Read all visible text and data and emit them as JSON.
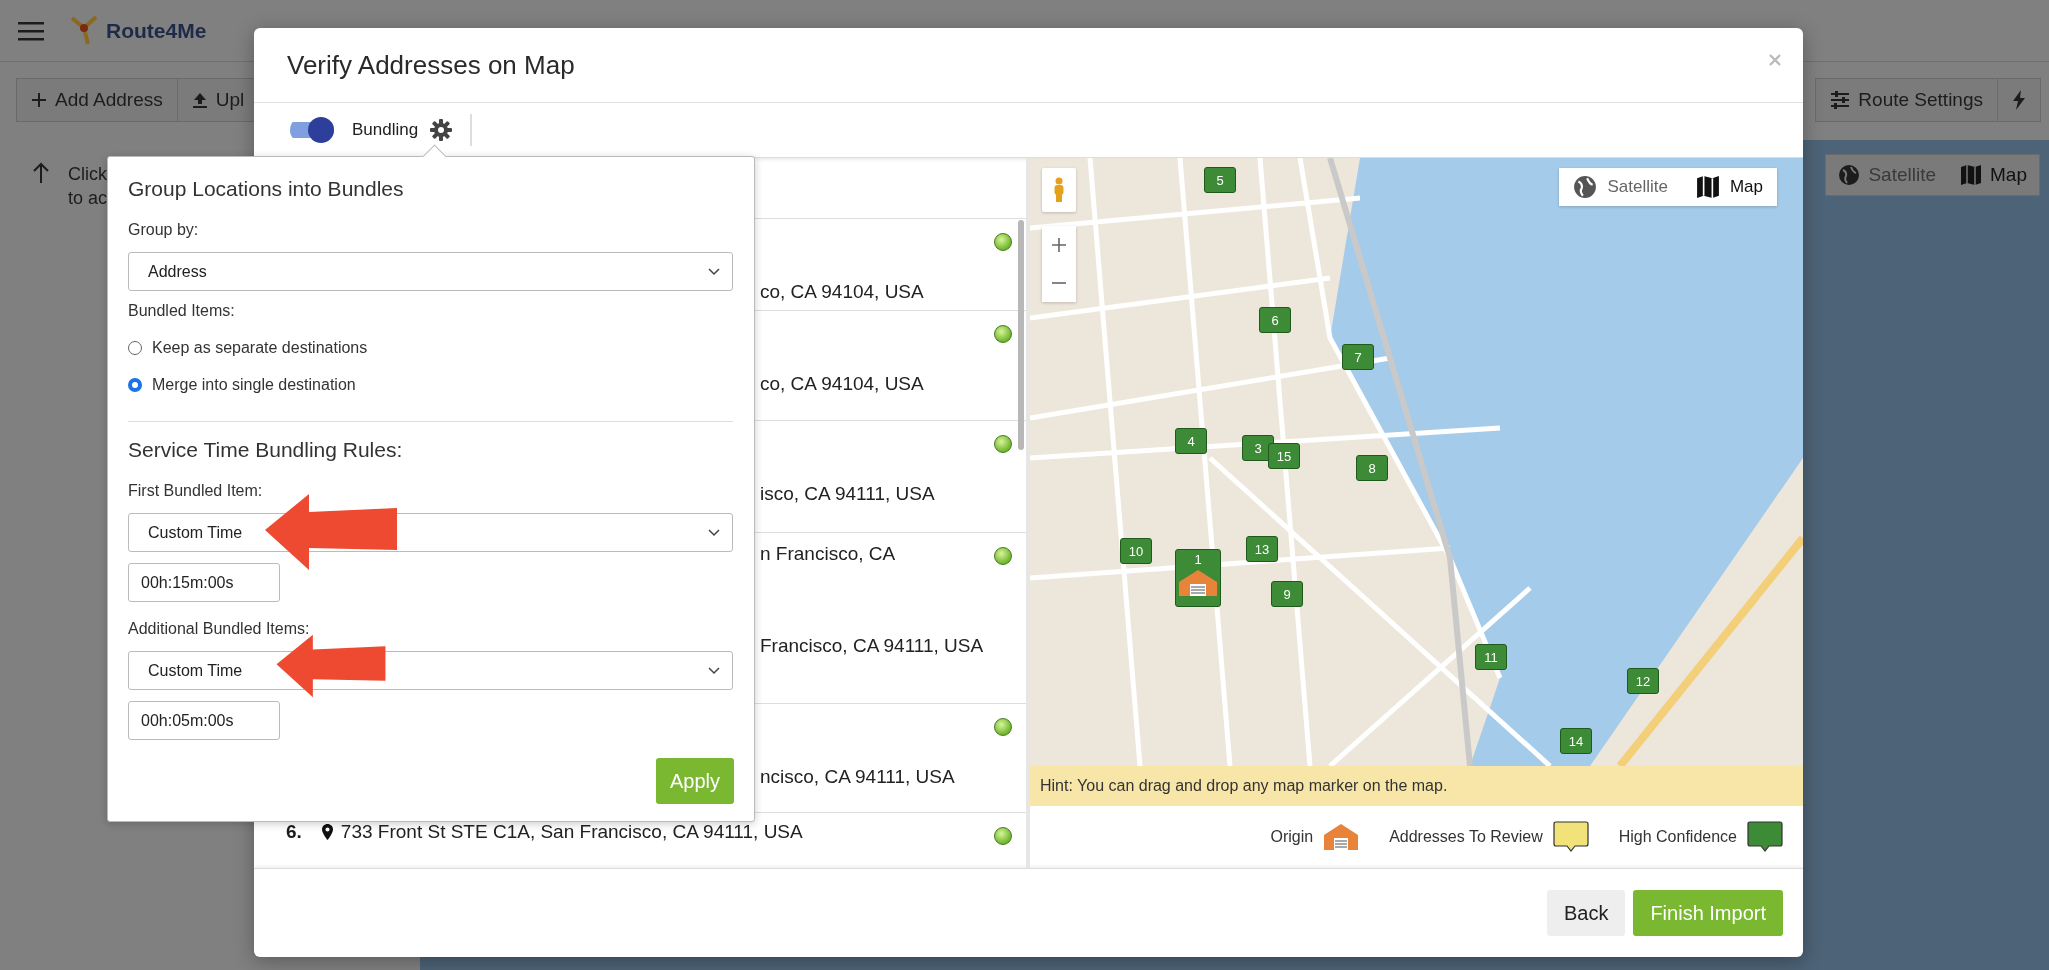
{
  "app": {
    "logo": "Route4Me",
    "toolbar_buttons": [
      "Add Address",
      "Upl"
    ],
    "hint_lines": [
      "Click",
      "to ac"
    ],
    "route_settings": "Route Settings",
    "map_types": [
      {
        "label": "Satellite",
        "selected": false
      },
      {
        "label": "Map",
        "selected": true
      }
    ]
  },
  "dialog": {
    "title": "Verify Addresses on Map",
    "bundling": {
      "label": "Bundling",
      "on": true
    },
    "addresses": [
      {
        "kind": "partial",
        "lines": [
          "co, CA 94104, USA"
        ]
      },
      {
        "kind": "partial",
        "lines": [
          "co, CA 94104, USA"
        ]
      },
      {
        "kind": "partial",
        "lines": [
          "isco, CA 94111, USA"
        ]
      },
      {
        "kind": "partial",
        "lines": [
          "n Francisco, CA",
          "Francisco, CA 94111, USA"
        ]
      },
      {
        "kind": "partial",
        "lines": [
          "ncisco, CA 94111, USA"
        ]
      },
      {
        "kind": "full",
        "number": "6.",
        "lines": [
          "733 Front St STE C1A, San Francisco, CA 94111, USA"
        ]
      }
    ],
    "map": {
      "map_types": [
        {
          "label": "Satellite",
          "selected": false
        },
        {
          "label": "Map",
          "selected": true
        }
      ],
      "markers": [
        {
          "label": "5",
          "kind": "stop"
        },
        {
          "label": "6",
          "kind": "stop"
        },
        {
          "label": "7",
          "kind": "stop"
        },
        {
          "label": "4",
          "kind": "stop"
        },
        {
          "label": "3",
          "kind": "stop"
        },
        {
          "label": "15",
          "kind": "stop"
        },
        {
          "label": "8",
          "kind": "stop"
        },
        {
          "label": "10",
          "kind": "stop"
        },
        {
          "label": "13",
          "kind": "stop"
        },
        {
          "label": "1",
          "kind": "origin"
        },
        {
          "label": "9",
          "kind": "stop"
        },
        {
          "label": "11",
          "kind": "stop"
        },
        {
          "label": "12",
          "kind": "stop"
        },
        {
          "label": "14",
          "kind": "stop"
        }
      ]
    },
    "hint": "Hint: You can drag and drop any map marker on the map.",
    "legend": [
      {
        "label": "Origin",
        "kind": "house",
        "color": "#e8833a"
      },
      {
        "label": "Addresses To Review",
        "kind": "pin",
        "color": "#f2e27a"
      },
      {
        "label": "High Confidence",
        "kind": "pin",
        "color": "#3d8a37"
      }
    ],
    "buttons": [
      {
        "label": "Back",
        "kind": "secondary"
      },
      {
        "label": "Finish Import",
        "kind": "primary"
      }
    ]
  },
  "bundle_popover": {
    "title": "Group Locations into Bundles",
    "group_by": {
      "label": "Group by:",
      "value": "Address"
    },
    "bundled_items": {
      "label": "Bundled Items:",
      "options": [
        {
          "label": "Keep as separate destinations",
          "selected": false
        },
        {
          "label": "Merge into single destination",
          "selected": true
        }
      ]
    },
    "section_title": "Service Time Bundling Rules:",
    "rules": [
      {
        "label": "First Bundled Item:",
        "value": "Custom Time",
        "time": "00h:15m:00s"
      },
      {
        "label": "Additional Bundled Items:",
        "value": "Custom Time",
        "time": "00h:05m:00s"
      }
    ],
    "apply": "Apply"
  }
}
